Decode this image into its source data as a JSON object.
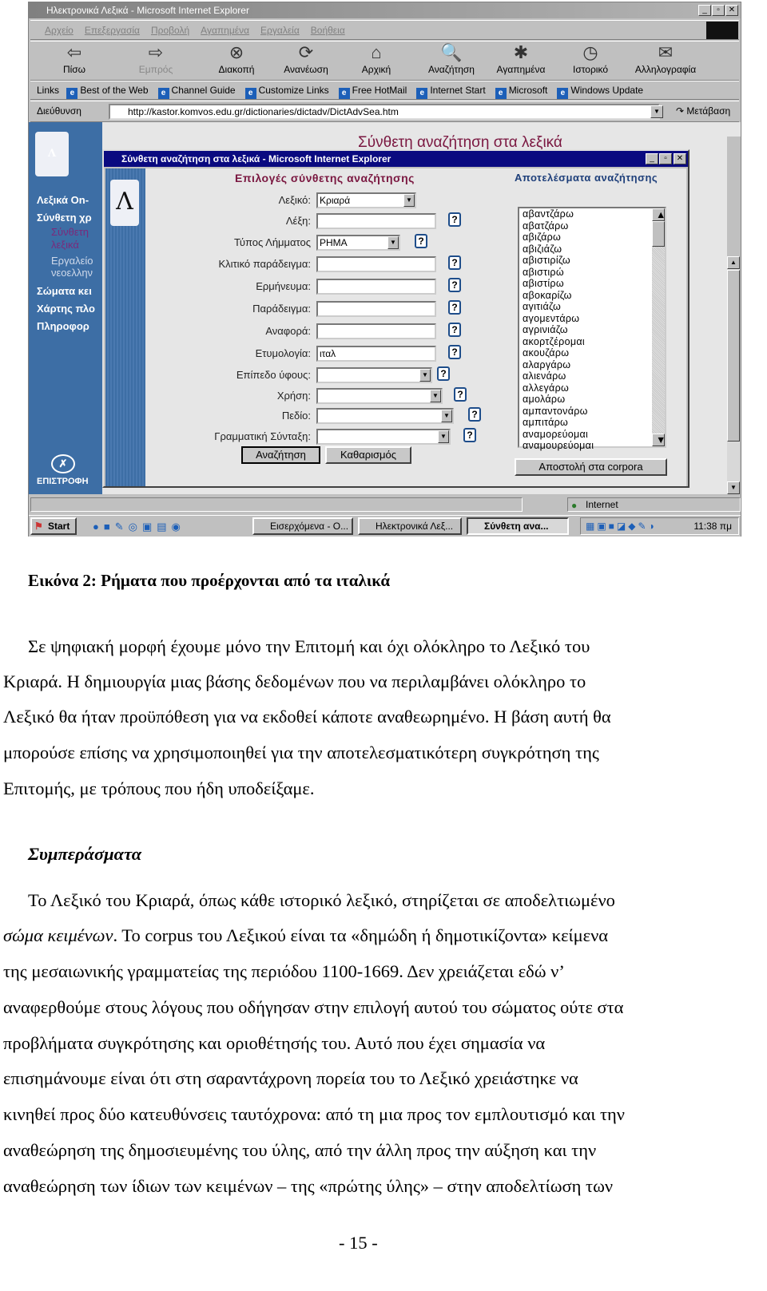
{
  "browser": {
    "title": "Ηλεκτρονικά Λεξικά - Microsoft Internet Explorer",
    "menu": [
      "Αρχείο",
      "Επεξεργασία",
      "Προβολή",
      "Αγαπημένα",
      "Εργαλεία",
      "Βοήθεια"
    ],
    "toolbar": [
      {
        "label": "Πίσω",
        "icon": "back-arrow-icon",
        "glyph": "⇦"
      },
      {
        "label": "Εμπρός",
        "icon": "forward-arrow-icon",
        "glyph": "⇨",
        "disabled": true
      },
      {
        "label": "Διακοπή",
        "icon": "stop-icon",
        "glyph": "⊗"
      },
      {
        "label": "Ανανέωση",
        "icon": "refresh-icon",
        "glyph": "⟳"
      },
      {
        "label": "Αρχική",
        "icon": "home-icon",
        "glyph": "⌂"
      },
      {
        "label": "Αναζήτηση",
        "icon": "search-icon",
        "glyph": "🔍"
      },
      {
        "label": "Αγαπημένα",
        "icon": "favorites-icon",
        "glyph": "✱"
      },
      {
        "label": "Ιστορικό",
        "icon": "history-icon",
        "glyph": "◷"
      },
      {
        "label": "Αλληλογραφία",
        "icon": "mail-icon",
        "glyph": "✉"
      }
    ],
    "links_label": "Links",
    "links": [
      "Best of the Web",
      "Channel Guide",
      "Customize Links",
      "Free HotMail",
      "Internet Start",
      "Microsoft",
      "Windows Update"
    ],
    "address_label": "Διεύθυνση",
    "address": "http://kastor.komvos.edu.gr/dictionaries/dictadv/DictAdvSea.htm",
    "go_label": "Μετάβαση",
    "status_zone": "Internet"
  },
  "site": {
    "heading": "Σύνθετη αναζήτηση στα λεξικά",
    "sidebar": [
      "Λεξικά On-",
      "Σύνθετη χρ",
      "Σύνθετη",
      "λεξικά",
      "Εργαλείο",
      "νεοελλην",
      "Σώματα κει",
      "Χάρτης πλο",
      "Πληροφορ"
    ],
    "return_label": "ΕΠΙΣΤΡΟΦΗ"
  },
  "dialog": {
    "title": "Σύνθετη αναζήτηση στα λεξικά - Microsoft Internet Explorer",
    "options_title": "Επιλογές σύνθετης αναζήτησης",
    "fields": [
      {
        "label": "Λεξικό:",
        "value": "Κριαρά",
        "type": "select"
      },
      {
        "label": "Λέξη:",
        "value": "",
        "type": "text"
      },
      {
        "label": "Τύπος Λήμματος",
        "value": "ΡΗΜΑ",
        "type": "select"
      },
      {
        "label": "Κλιτικό παράδειγμα:",
        "value": "",
        "type": "text"
      },
      {
        "label": "Ερμήνευμα:",
        "value": "",
        "type": "text"
      },
      {
        "label": "Παράδειγμα:",
        "value": "",
        "type": "text"
      },
      {
        "label": "Αναφορά:",
        "value": "",
        "type": "text"
      },
      {
        "label": "Ετυμολογία:",
        "value": "ιταλ",
        "type": "text"
      },
      {
        "label": "Επίπεδο ύφους:",
        "value": "",
        "type": "select"
      },
      {
        "label": "Χρήση:",
        "value": "",
        "type": "select"
      },
      {
        "label": "Πεδίο:",
        "value": "",
        "type": "select"
      },
      {
        "label": "Γραμματική Σύνταξη:",
        "value": "",
        "type": "select"
      }
    ],
    "search_button": "Αναζήτηση",
    "clear_button": "Καθαρισμός",
    "results_title": "Αποτελέσματα αναζήτησης",
    "results": [
      "αβαντζάρω",
      "αβατζάρω",
      "αβιζάρω",
      "αβιζιάζω",
      "αβιστιρίζω",
      "αβιστιρώ",
      "αβιστίρω",
      "αβοκαρίζω",
      "αγιτιάζω",
      "αγομεντάρω",
      "αγρινιάζω",
      "ακορτζέρομαι",
      "ακουζάρω",
      "αλαργάρω",
      "αλιενάρω",
      "αλλεγάρω",
      "αμολάρω",
      "αμπαντονάρω",
      "αμπιτάρω",
      "αναμορεύομαι",
      "αναμουρεύομαι"
    ],
    "corpora_button": "Αποστολή στα corpora"
  },
  "taskbar": {
    "start": "Start",
    "tasks": [
      "Εισερχόμενα - O...",
      "Ηλεκτρονικά Λεξ...",
      "Σύνθετη ανα..."
    ],
    "clock": "11:38 πμ"
  },
  "document": {
    "caption": "Εικόνα 2: Ρήματα που προέρχονται από τα ιταλικά",
    "para1": [
      "Σε ψηφιακή μορφή έχουμε μόνο την Επιτομή και όχι ολόκληρο το Λεξικό του",
      "Κριαρά. Η δημιουργία μιας βάσης δεδομένων που να περιλαμβάνει ολόκληρο το",
      "Λεξικό θα ήταν προϋπόθεση για να εκδοθεί κάποτε αναθεωρημένο. Η βάση αυτή θα",
      "μπορούσε επίσης να χρησιμοποιηθεί για την αποτελεσματικότερη συγκρότηση της",
      "Επιτομής, με τρόπους που ήδη υποδείξαμε."
    ],
    "heading": "Συμπεράσματα",
    "para2_line1": "Το Λεξικό του Κριαρά, όπως κάθε ιστορικό λεξικό, στηρίζεται σε αποδελτιωμένο",
    "para2_line2_italic": "σώμα κειμένων",
    "para2_line2_rest": ". Το corpus του Λεξικού είναι τα «δημώδη ή δημοτικίζοντα» κείμενα",
    "para2": [
      "της μεσαιωνικής γραμματείας της περιόδου 1100-1669. Δεν χρειάζεται εδώ ν’",
      "αναφερθούμε στους λόγους που οδήγησαν στην επιλογή αυτού του σώματος ούτε στα",
      "προβλήματα συγκρότησης και οριοθέτησής του. Αυτό που έχει σημασία να",
      "επισημάνουμε είναι ότι στη σαραντάχρονη πορεία του το Λεξικό χρειάστηκε να",
      "κινηθεί προς δύο κατευθύνσεις ταυτόχρονα: από τη μια προς τον εμπλουτισμό και την",
      "αναθεώρηση της δημοσιευμένης του ύλης, από την άλλη προς την αύξηση και την",
      "αναθεώρηση των ίδιων των κειμένων – της «πρώτης ύλης» – στην αποδελτίωση των"
    ],
    "page_number": "- 15 -"
  }
}
